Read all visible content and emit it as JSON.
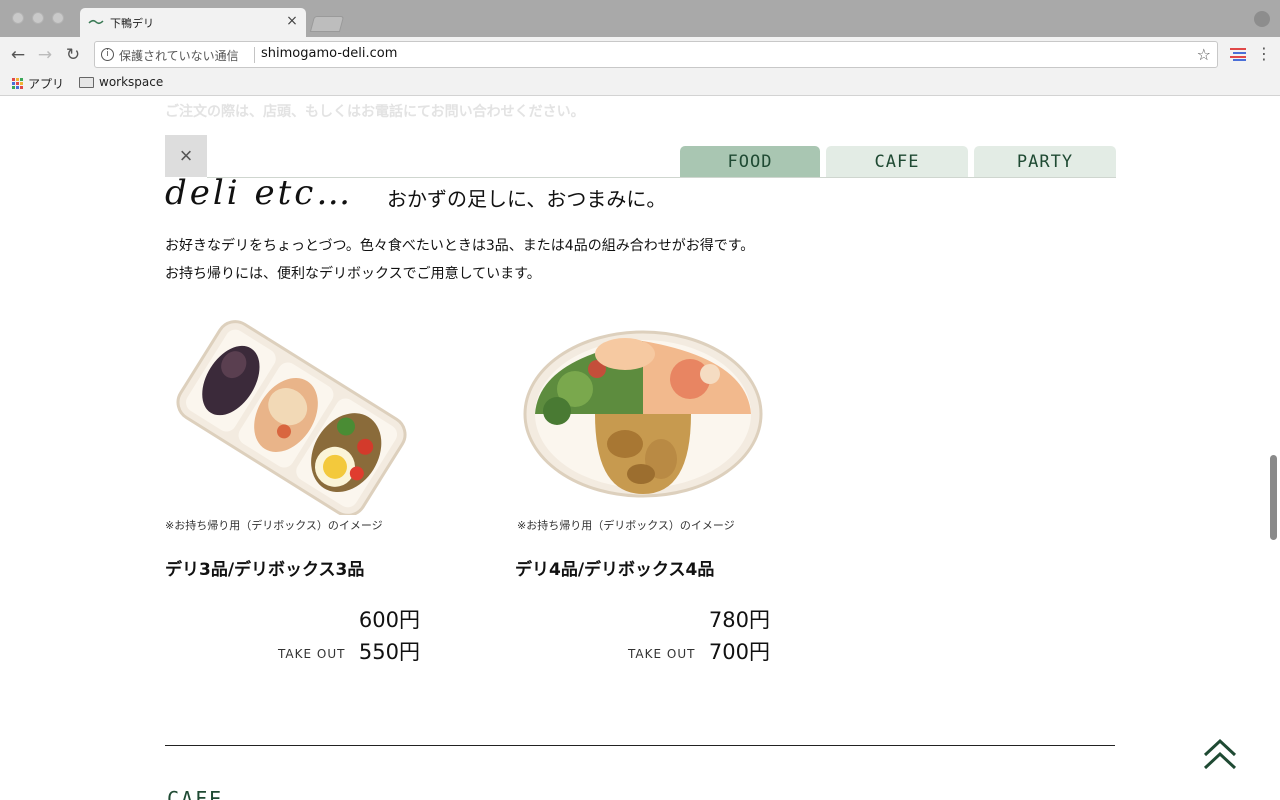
{
  "browser": {
    "tab_title": "下鴨デリ",
    "tab_close": "×",
    "security_label": "保護されていない通信",
    "url": "shimogamo-deli.com",
    "bookmarks": {
      "apps_label": "アプリ",
      "folder_label": "workspace"
    },
    "icons": {
      "back": "arrow-left",
      "forward": "arrow-right",
      "reload": "reload",
      "info": "info-circle",
      "star": "star-outline",
      "menu": "vertical-dots"
    }
  },
  "page": {
    "faded_notice": "ご注文の際は、店頭、もしくはお電話にてお問い合わせください。",
    "close_symbol": "×",
    "tabs": [
      {
        "label": "FOOD",
        "active": true
      },
      {
        "label": "CAFE",
        "active": false
      },
      {
        "label": "PARTY",
        "active": false
      }
    ],
    "section": {
      "heading": "deli etc…",
      "subheading": "おかずの足しに、おつまみに。",
      "description": [
        "お好きなデリをちょっとづつ。色々食べたいときは3品、または4品の組み合わせがお得です。",
        "お持ち帰りには、便利なデリボックスでご用意しています。"
      ]
    },
    "products": [
      {
        "caption": "※お持ち帰り用（デリボックス）のイメージ",
        "name": "デリ3品/デリボックス3品",
        "price": "600円",
        "takeout_label": "TAKE OUT",
        "takeout_price": "550円"
      },
      {
        "caption": "※お持ち帰り用（デリボックス）のイメージ",
        "name": "デリ4品/デリボックス4品",
        "price": "780円",
        "takeout_label": "TAKE OUT",
        "takeout_price": "700円"
      }
    ],
    "next_section_heading": "CAFE"
  },
  "colors": {
    "tab_active": "#a9c6b2",
    "tab_inactive": "#e3ece5",
    "brand_green": "#1f4a33"
  }
}
